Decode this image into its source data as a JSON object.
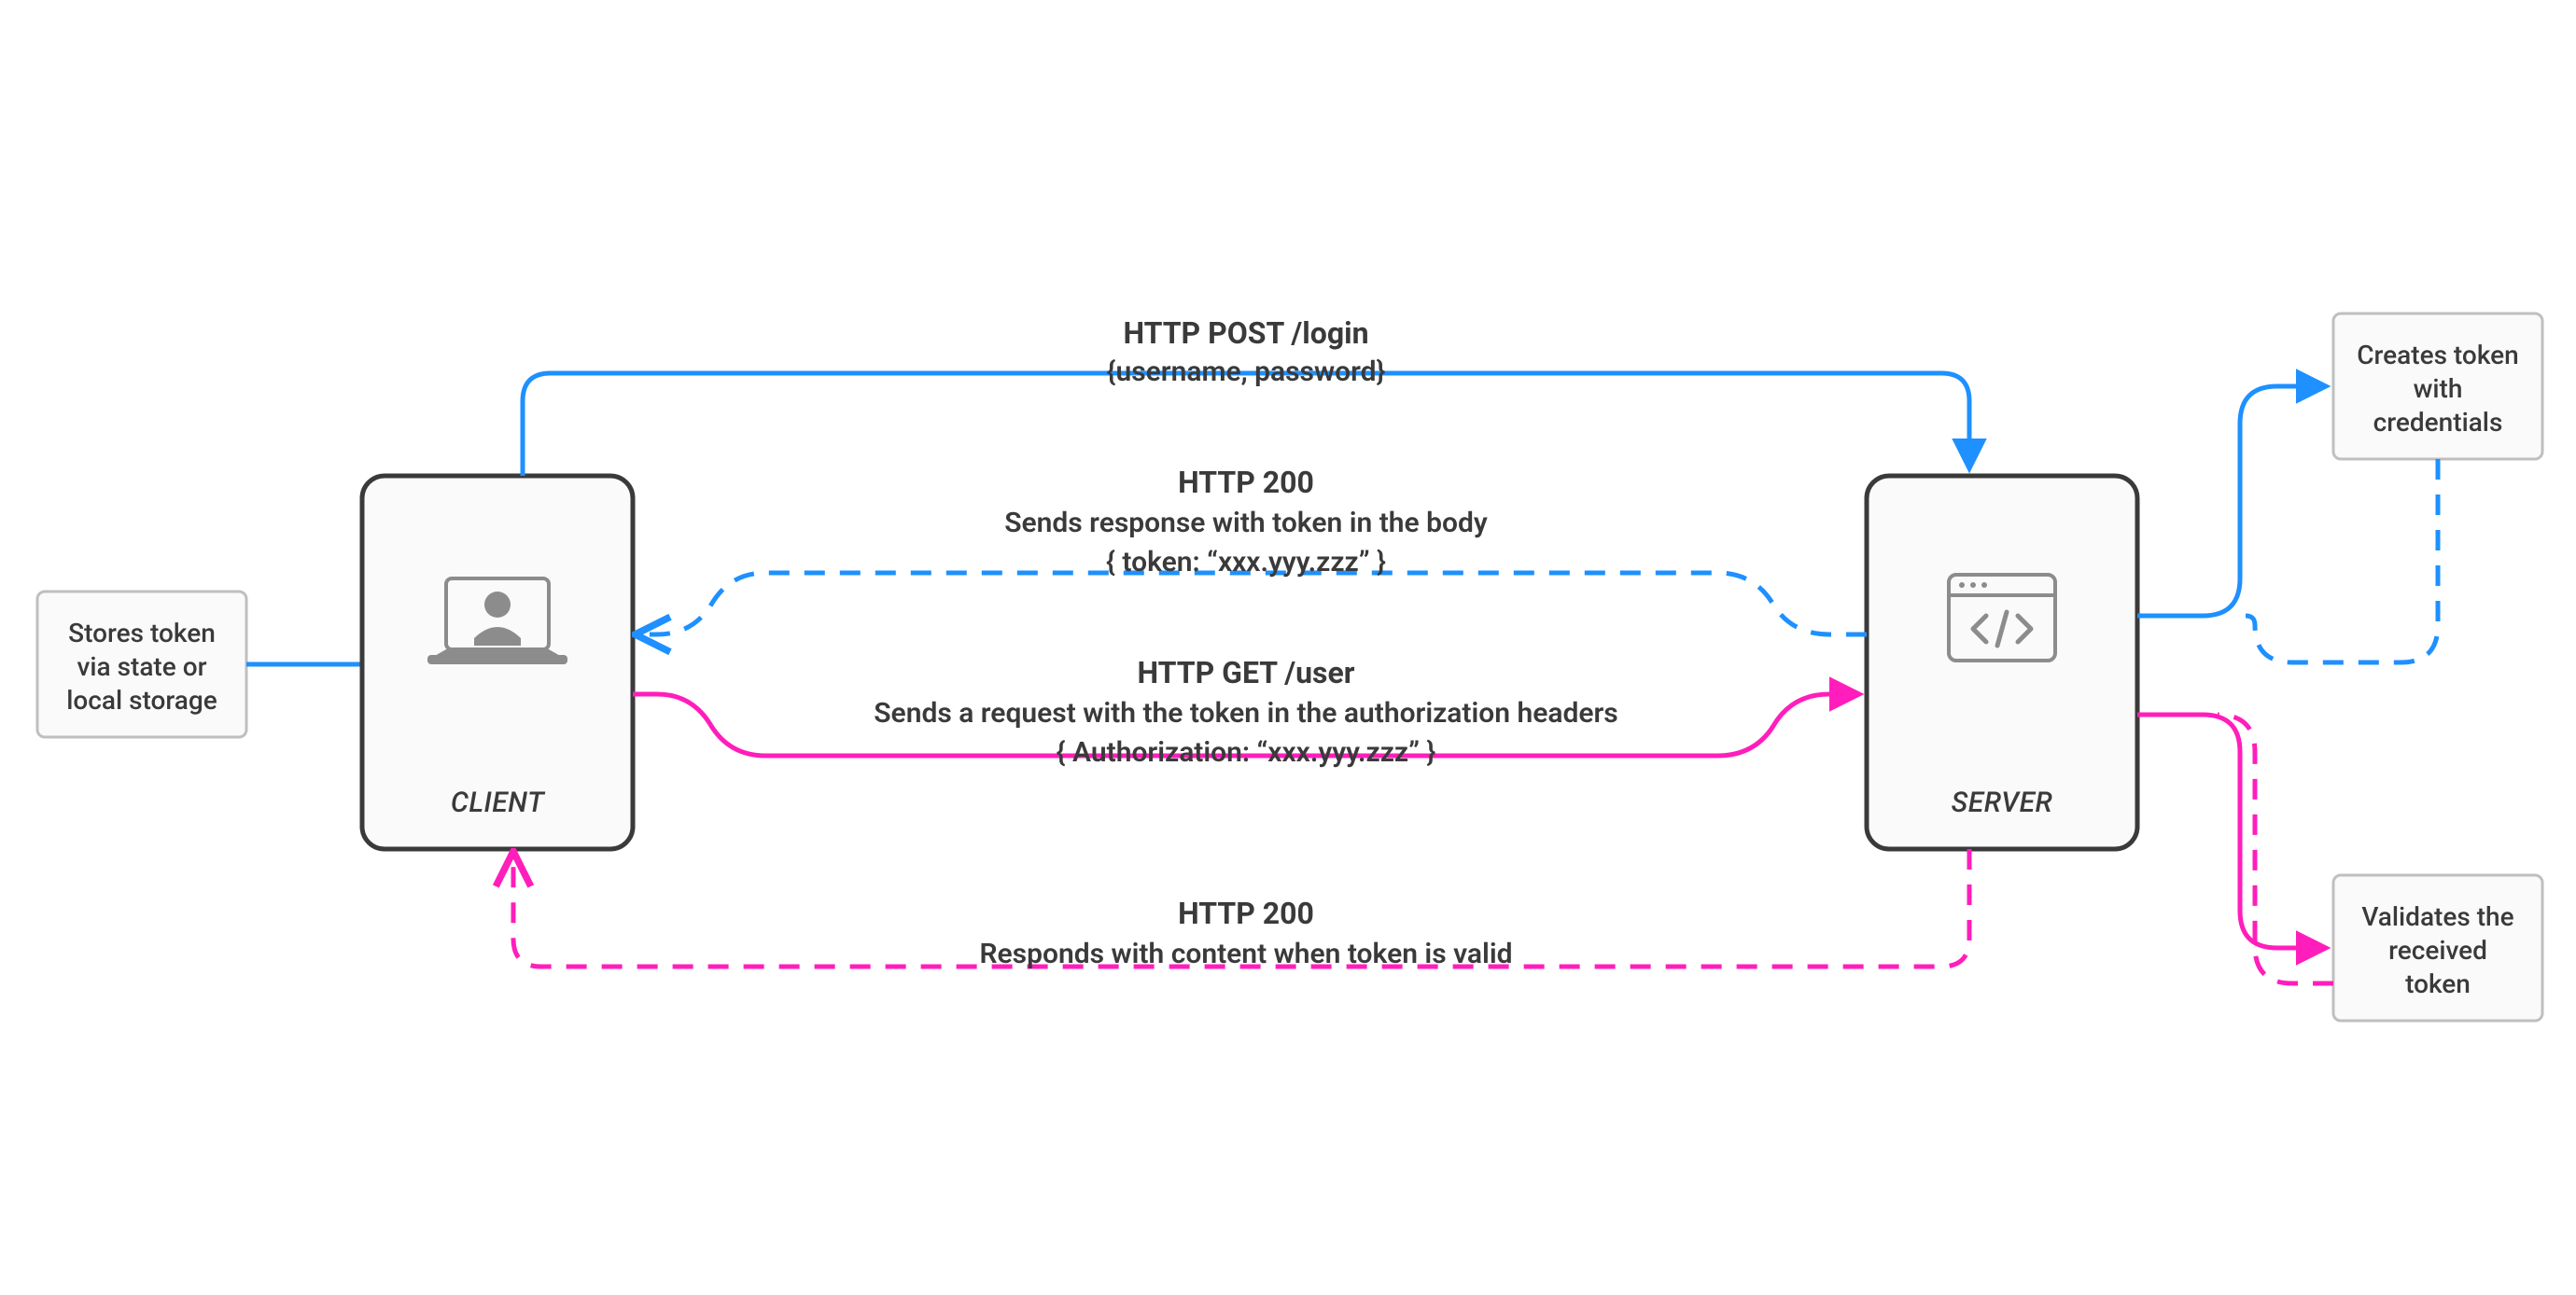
{
  "colors": {
    "blue": "#1E90FF",
    "magenta": "#FF1EBB",
    "grey": "#BFBFBF",
    "darkGrey": "#8C8C8C",
    "boxFill": "#FAFAFA",
    "text": "#3a3a3a"
  },
  "client": {
    "label": "CLIENT"
  },
  "server": {
    "label": "SERVER"
  },
  "storage": {
    "line1": "Stores token",
    "line2": "via state or",
    "line3": "local storage"
  },
  "createToken": {
    "line1": "Creates token",
    "line2": "with",
    "line3": "credentials"
  },
  "validateToken": {
    "line1": "Validates the",
    "line2": "received",
    "line3": "token"
  },
  "flow1": {
    "title": "HTTP POST /login",
    "sub": "{username, password}"
  },
  "flow2": {
    "title": "HTTP 200",
    "sub1": "Sends response with token in the body",
    "sub2": "{ token: “xxx.yyy.zzz” }"
  },
  "flow3": {
    "title": "HTTP GET /user",
    "sub1": "Sends a request with the token in the authorization headers",
    "sub2": "{ Authorization: “xxx.yyy.zzz” }"
  },
  "flow4": {
    "title": "HTTP 200",
    "sub1": "Responds with content when token is valid"
  }
}
